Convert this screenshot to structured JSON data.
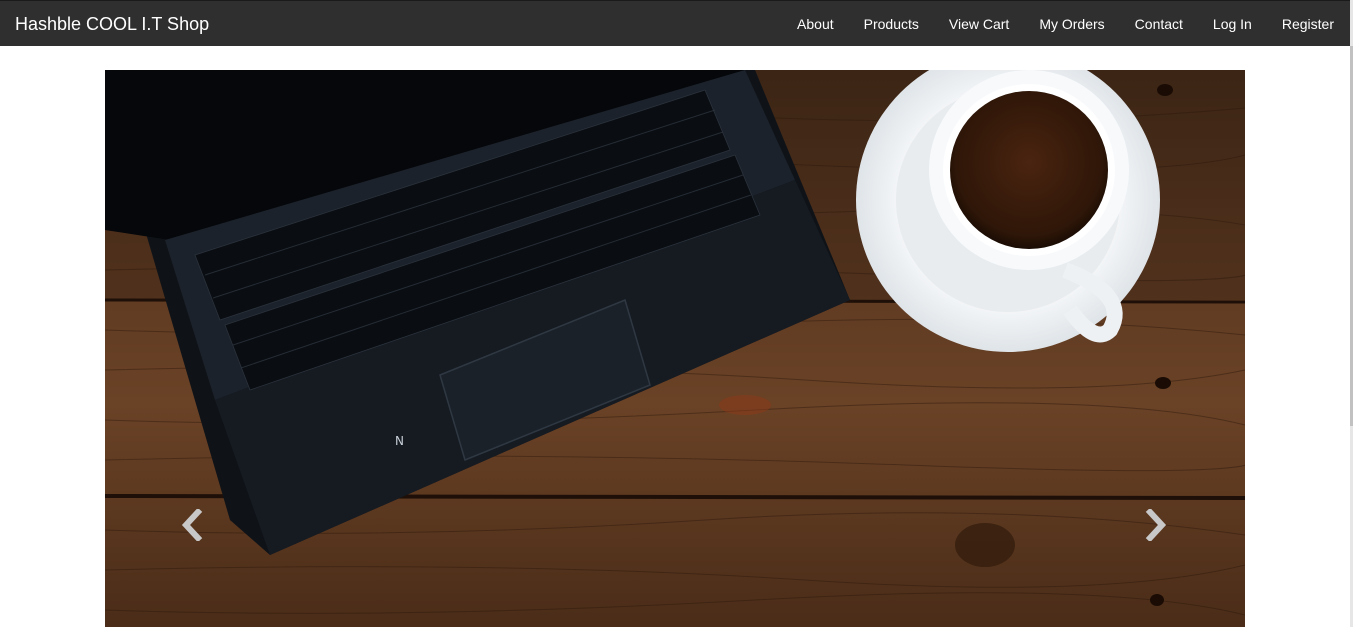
{
  "navbar": {
    "brand": "Hashble COOL I.T Shop",
    "links": [
      "About",
      "Products",
      "View Cart",
      "My Orders",
      "Contact",
      "Log In",
      "Register"
    ]
  },
  "carousel": {
    "prev_icon": "chevron-left-icon",
    "next_icon": "chevron-right-icon",
    "slide_image": "laptop-and-coffee-on-wooden-desk"
  },
  "colors": {
    "navbar_bg": "#2f2f2f",
    "nav_text": "#ffffff",
    "wood": "#5a3620",
    "laptop": "#151a22",
    "cup": "#f4f6f8",
    "coffee": "#3a1d0e"
  }
}
